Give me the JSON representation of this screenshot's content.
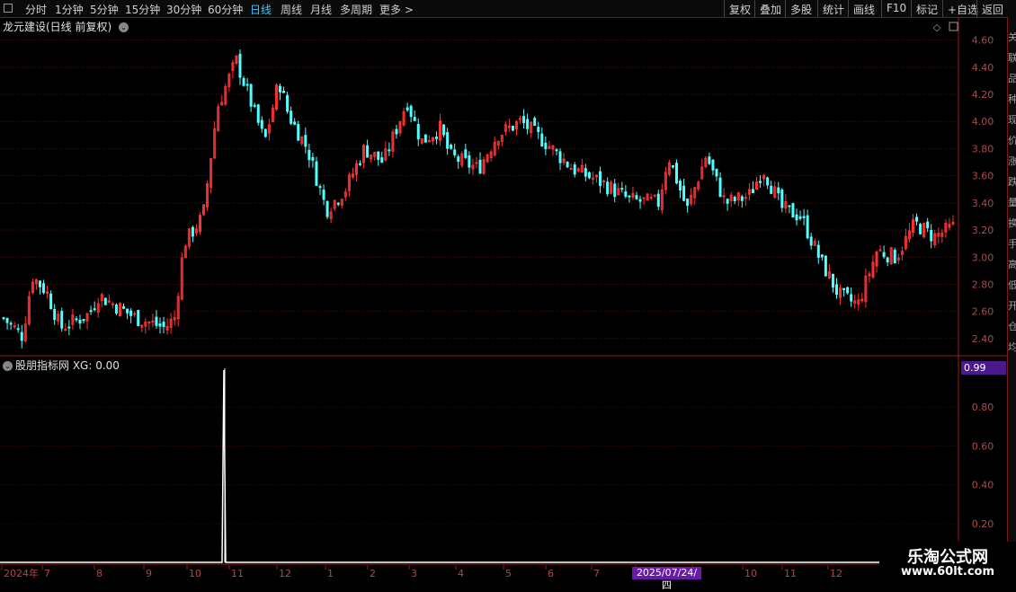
{
  "toolbar": {
    "tabs": [
      "分时",
      "1分钟",
      "5分钟",
      "15分钟",
      "30分钟",
      "60分钟",
      "日线",
      "周线",
      "月线",
      "多周期",
      "更多 >"
    ],
    "active_tab": "日线",
    "right_buttons": [
      "复权",
      "叠加",
      "多股",
      "统计",
      "画线",
      "F10",
      "标记",
      "+自选",
      "返回"
    ]
  },
  "chart_title": "龙元建设(日线 前复权)",
  "indicator_title": "股朋指标网  XG: 0.00",
  "indicator_badge": "0.99",
  "cursor_date": "2025/07/24/四",
  "watermark": {
    "title": "乐淘公式网",
    "url": "www.60lt.com"
  },
  "right_strip_chars": [
    "关",
    "联",
    "品",
    "种",
    "现",
    "价",
    "涨",
    "跌",
    "量",
    "换",
    "手",
    "高",
    "低",
    "开",
    "仓",
    "均"
  ],
  "colors": {
    "up": "#ff3232",
    "down": "#52ffff",
    "grid": "#8a1a1a",
    "axis_text": "#b04848",
    "signal": "#ffffff"
  },
  "chart_data": [
    {
      "type": "candlestick",
      "title": "龙元建设(日线 前复权)",
      "ylim": [
        2.3,
        4.65
      ],
      "y_ticks": [
        "4.60",
        "4.40",
        "4.20",
        "4.00",
        "3.80",
        "3.60",
        "3.40",
        "3.20",
        "3.00",
        "2.80",
        "2.60",
        "2.40"
      ],
      "x_ticks": [
        "2024年",
        "7",
        "8",
        "9",
        "10",
        "11",
        "12",
        "1",
        "2",
        "3",
        "4",
        "5",
        "6",
        "7",
        "8",
        "9",
        "10",
        "11",
        "12"
      ],
      "close_path": [
        {
          "t": 0,
          "close": 2.55
        },
        {
          "t": 0.02,
          "close": 2.42
        },
        {
          "t": 0.03,
          "close": 2.86
        },
        {
          "t": 0.045,
          "close": 2.75
        },
        {
          "t": 0.06,
          "close": 2.48
        },
        {
          "t": 0.09,
          "close": 2.58
        },
        {
          "t": 0.1,
          "close": 2.72
        },
        {
          "t": 0.14,
          "close": 2.55
        },
        {
          "t": 0.17,
          "close": 2.48
        },
        {
          "t": 0.18,
          "close": 2.55
        },
        {
          "t": 0.19,
          "close": 3.1
        },
        {
          "t": 0.21,
          "close": 3.3
        },
        {
          "t": 0.225,
          "close": 4.1
        },
        {
          "t": 0.245,
          "close": 4.45
        },
        {
          "t": 0.26,
          "close": 4.15
        },
        {
          "t": 0.275,
          "close": 3.85
        },
        {
          "t": 0.29,
          "close": 4.3
        },
        {
          "t": 0.3,
          "close": 4.05
        },
        {
          "t": 0.32,
          "close": 3.8
        },
        {
          "t": 0.34,
          "close": 3.35
        },
        {
          "t": 0.36,
          "close": 3.5
        },
        {
          "t": 0.38,
          "close": 3.8
        },
        {
          "t": 0.4,
          "close": 3.7
        },
        {
          "t": 0.425,
          "close": 4.15
        },
        {
          "t": 0.44,
          "close": 3.85
        },
        {
          "t": 0.46,
          "close": 3.95
        },
        {
          "t": 0.47,
          "close": 3.75
        },
        {
          "t": 0.5,
          "close": 3.65
        },
        {
          "t": 0.52,
          "close": 3.9
        },
        {
          "t": 0.545,
          "close": 4.0
        },
        {
          "t": 0.57,
          "close": 3.85
        },
        {
          "t": 0.6,
          "close": 3.65
        },
        {
          "t": 0.63,
          "close": 3.55
        },
        {
          "t": 0.66,
          "close": 3.42
        },
        {
          "t": 0.69,
          "close": 3.4
        },
        {
          "t": 0.7,
          "close": 3.75
        },
        {
          "t": 0.72,
          "close": 3.35
        },
        {
          "t": 0.74,
          "close": 3.75
        },
        {
          "t": 0.76,
          "close": 3.4
        },
        {
          "t": 0.785,
          "close": 3.45
        },
        {
          "t": 0.8,
          "close": 3.65
        },
        {
          "t": 0.82,
          "close": 3.36
        },
        {
          "t": 0.84,
          "close": 3.3
        },
        {
          "t": 0.86,
          "close": 2.98
        },
        {
          "t": 0.88,
          "close": 2.72
        },
        {
          "t": 0.9,
          "close": 2.65
        },
        {
          "t": 0.92,
          "close": 3.05
        },
        {
          "t": 0.94,
          "close": 3.0
        },
        {
          "t": 0.96,
          "close": 3.25
        },
        {
          "t": 0.98,
          "close": 3.15
        },
        {
          "t": 1.0,
          "close": 3.22
        }
      ]
    },
    {
      "type": "line",
      "title": "XG",
      "ylim": [
        0,
        1.0
      ],
      "y_ticks": [
        "0.80",
        "0.60",
        "0.40",
        "0.20"
      ],
      "signal_position": 0.233,
      "signal_value": 1.0
    }
  ]
}
